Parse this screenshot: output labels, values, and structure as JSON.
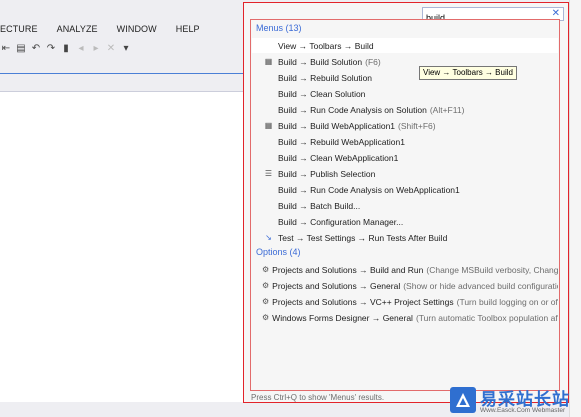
{
  "ide": {
    "menu": [
      "ECTURE",
      "ANALYZE",
      "WINDOW",
      "HELP"
    ],
    "toolbar_icons": [
      "indent-icon",
      "outdent-icon",
      "undo-icon",
      "redo-icon",
      "bookmark-icon",
      "bookmark-prev-icon",
      "bookmark-next-icon",
      "bookmark-clear-icon",
      "overflow-icon"
    ]
  },
  "quick_launch": {
    "search_value": "build",
    "menus_header": "Menus (13)",
    "menus": [
      {
        "label": "View → Toolbars → Build",
        "hint": "",
        "icon": "",
        "selected": true
      },
      {
        "label": "Build → Build Solution",
        "hint": "(F6)",
        "icon": "build-solution-icon"
      },
      {
        "label": "Build → Rebuild Solution",
        "hint": "",
        "icon": ""
      },
      {
        "label": "Build → Clean Solution",
        "hint": "",
        "icon": ""
      },
      {
        "label": "Build → Run Code Analysis on Solution",
        "hint": "(Alt+F11)",
        "icon": ""
      },
      {
        "label": "Build → Build WebApplication1",
        "hint": "(Shift+F6)",
        "icon": "build-project-icon"
      },
      {
        "label": "Build → Rebuild WebApplication1",
        "hint": "",
        "icon": ""
      },
      {
        "label": "Build → Clean WebApplication1",
        "hint": "",
        "icon": ""
      },
      {
        "label": "Build → Publish Selection",
        "hint": "",
        "icon": "publish-icon"
      },
      {
        "label": "Build → Run Code Analysis on WebApplication1",
        "hint": "",
        "icon": ""
      },
      {
        "label": "Build → Batch Build...",
        "hint": "",
        "icon": ""
      },
      {
        "label": "Build → Configuration Manager...",
        "hint": "",
        "icon": ""
      },
      {
        "label": "Test → Test Settings → Run Tests After Build",
        "hint": "",
        "icon": "test-settings-icon"
      }
    ],
    "options_header": "Options (4)",
    "options": [
      {
        "label": "Projects and Solutions → Build and Run",
        "hint": "(Change MSBuild verbosity, Change the nu..."
      },
      {
        "label": "Projects and Solutions → General",
        "hint": "(Show or hide advanced build configurations, Sho..."
      },
      {
        "label": "Projects and Solutions → VC++ Project Settings",
        "hint": "(Turn build logging on or off, Turn..."
      },
      {
        "label": "Windows Forms Designer → General",
        "hint": "(Turn automatic Toolbox population after rebui..."
      }
    ],
    "tooltip": "View → Toolbars → Build",
    "footer": "Press Ctrl+Q to show 'Menus' results."
  },
  "watermark": {
    "brand": "易采站长站",
    "sub": "Www.Easck.Com  Webmaster"
  },
  "colors": {
    "accent": "#3b6bd6",
    "border_red": "#e2232a"
  }
}
